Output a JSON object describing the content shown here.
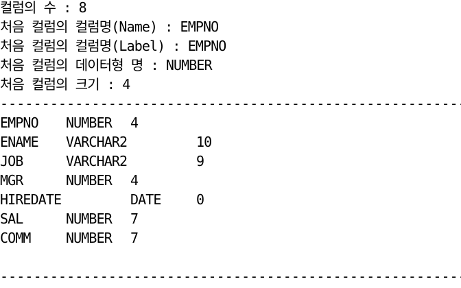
{
  "summary": {
    "column_count": "컬럼의 수 : 8",
    "first_column_name": "처음 컬럼의 컬럼명(Name) : EMPNO",
    "first_column_label": "처음 컬럼의 컬럼명(Label) : EMPNO",
    "first_column_type": "처음 컬럼의 데이터형 명 : NUMBER",
    "first_column_size": "처음 컬럼의 크기 : 4"
  },
  "separator": "------------------------------------------------------------",
  "columns": [
    {
      "name": "EMPNO",
      "type": "NUMBER",
      "size": "4",
      "layout": "short"
    },
    {
      "name": "ENAME",
      "type": "VARCHAR2",
      "size": "10",
      "layout": "long"
    },
    {
      "name": "JOB",
      "type": "VARCHAR2",
      "size": "9",
      "layout": "long"
    },
    {
      "name": "MGR",
      "type": "NUMBER",
      "size": "4",
      "layout": "short"
    },
    {
      "name": "HIREDATE",
      "type": "DATE",
      "size": "0",
      "layout": "shifted"
    },
    {
      "name": "SAL",
      "type": "NUMBER",
      "size": "7",
      "layout": "short"
    },
    {
      "name": "COMM",
      "type": "NUMBER",
      "size": "7",
      "layout": "short"
    }
  ]
}
